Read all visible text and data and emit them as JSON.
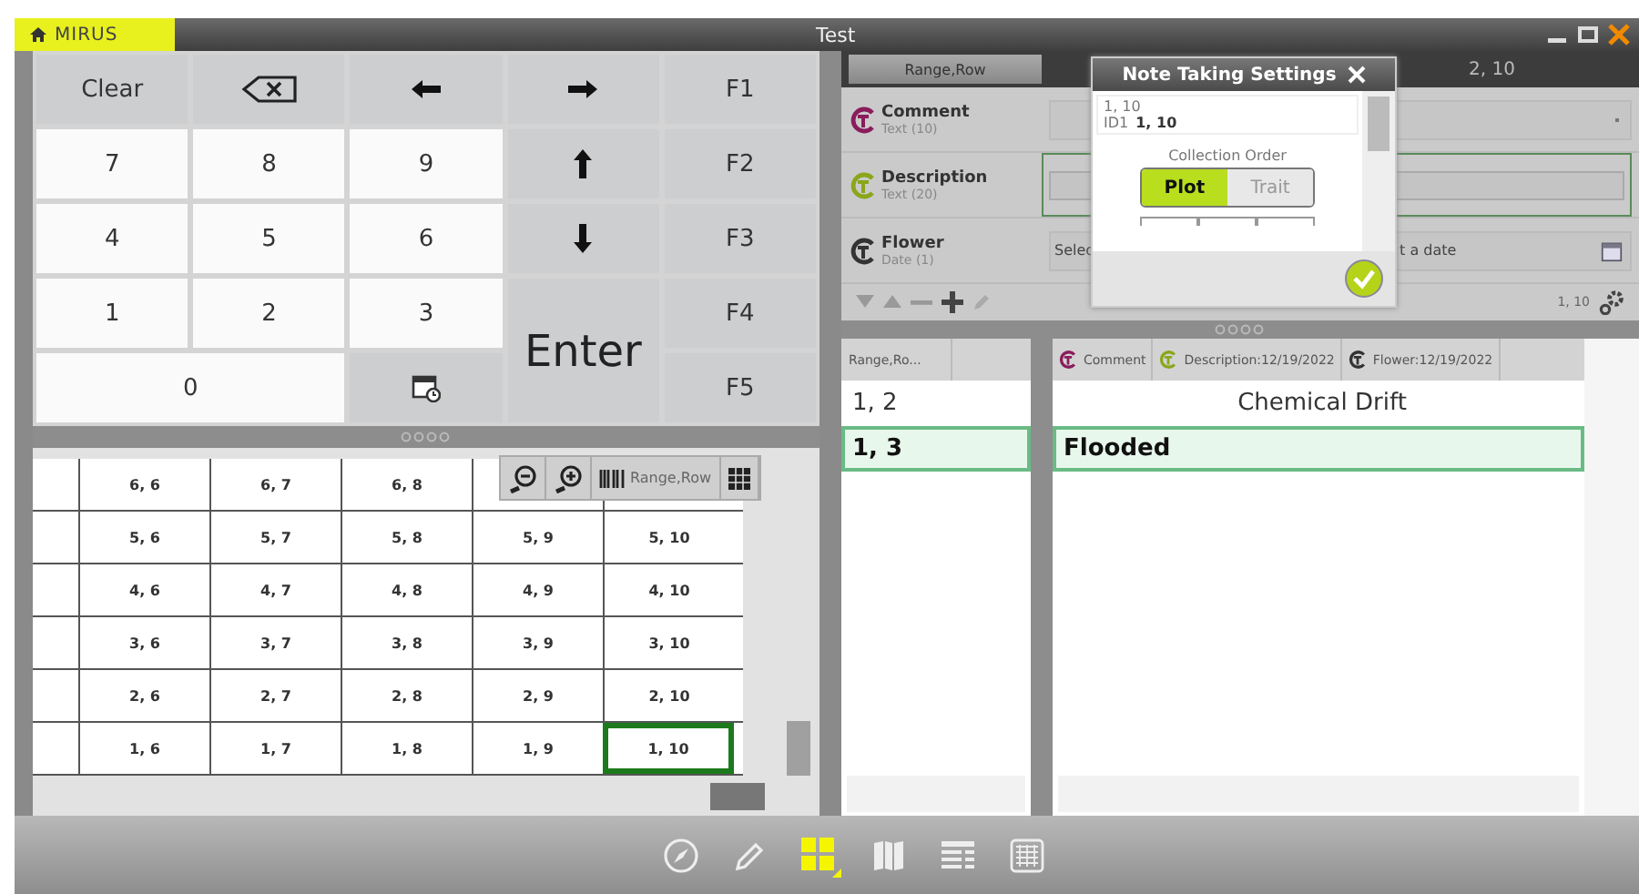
{
  "window": {
    "brand": "MIRUS",
    "title": "Test"
  },
  "keypad": [
    {
      "kind": "text",
      "label": "Clear"
    },
    {
      "kind": "backspace"
    },
    {
      "kind": "left"
    },
    {
      "kind": "right"
    },
    {
      "kind": "text",
      "label": "F1"
    },
    {
      "kind": "digit",
      "label": "7"
    },
    {
      "kind": "digit",
      "label": "8"
    },
    {
      "kind": "digit",
      "label": "9"
    },
    {
      "kind": "up"
    },
    {
      "kind": "text",
      "label": "F2"
    },
    {
      "kind": "digit",
      "label": "4"
    },
    {
      "kind": "digit",
      "label": "5"
    },
    {
      "kind": "digit",
      "label": "6"
    },
    {
      "kind": "down"
    },
    {
      "kind": "text",
      "label": "F3"
    },
    {
      "kind": "digit",
      "label": "1"
    },
    {
      "kind": "digit",
      "label": "2"
    },
    {
      "kind": "digit",
      "label": "3"
    },
    {
      "kind": "enter",
      "label": "Enter"
    },
    {
      "kind": "text",
      "label": "F4"
    },
    {
      "kind": "zero",
      "label": "0"
    },
    {
      "kind": "calendar"
    },
    {
      "kind": "text",
      "label": "F5"
    }
  ],
  "plot_grid": {
    "rows": [
      [
        {
          "text": "6, 6",
          "selected": false
        },
        {
          "text": "6, 7",
          "selected": false
        },
        {
          "text": "6, 8",
          "selected": false
        }
      ],
      [
        {
          "text": "5, 6",
          "selected": false
        },
        {
          "text": "5, 7",
          "selected": false
        },
        {
          "text": "5, 8",
          "selected": false
        },
        {
          "text": "5, 9",
          "selected": false
        },
        {
          "text": "5, 10",
          "selected": false
        }
      ],
      [
        {
          "text": "4, 6",
          "selected": false
        },
        {
          "text": "4, 7",
          "selected": false
        },
        {
          "text": "4, 8",
          "selected": false
        },
        {
          "text": "4, 9",
          "selected": false
        },
        {
          "text": "4, 10",
          "selected": false
        }
      ],
      [
        {
          "text": "3, 6",
          "selected": false
        },
        {
          "text": "3, 7",
          "selected": false
        },
        {
          "text": "3, 8",
          "selected": false
        },
        {
          "text": "3, 9",
          "selected": false
        },
        {
          "text": "3, 10",
          "selected": false
        }
      ],
      [
        {
          "text": "2, 6",
          "selected": false
        },
        {
          "text": "2, 7",
          "selected": false
        },
        {
          "text": "2, 8",
          "selected": false
        },
        {
          "text": "2, 9",
          "selected": false
        },
        {
          "text": "2, 10",
          "selected": false
        }
      ],
      [
        {
          "text": "1, 6",
          "selected": false
        },
        {
          "text": "1, 7",
          "selected": false
        },
        {
          "text": "1, 8",
          "selected": false
        },
        {
          "text": "1, 9",
          "selected": false
        },
        {
          "text": "1, 10",
          "selected": true
        }
      ]
    ],
    "toolbar_label": "Range,Row"
  },
  "entry": {
    "range_row_button": "Range,Row",
    "current_plot": "2, 10",
    "traits": [
      {
        "name": "Comment",
        "type": "Text (10)",
        "color": "#8a1c5c",
        "kind": "dropdown"
      },
      {
        "name": "Description",
        "type": "Text (20)",
        "color": "#8aa61a",
        "kind": "text"
      },
      {
        "name": "Flower",
        "type": "Date (1)",
        "color": "#333333",
        "kind": "date",
        "value_start": "Selec",
        "value_end": "t a date"
      }
    ],
    "position": "1, 10"
  },
  "dialog": {
    "title": "Note Taking Settings",
    "line_1": "1, 10",
    "id_label": "ID1",
    "id_value": "1, 10",
    "order_label": "Collection Order",
    "options": [
      {
        "label": "Plot",
        "selected": true
      },
      {
        "label": "Trait",
        "selected": false
      }
    ]
  },
  "notes": {
    "left_header": "Range,Ro...",
    "left_rows": [
      {
        "text": "1, 2",
        "selected": false
      },
      {
        "text": "1, 3",
        "selected": true
      }
    ],
    "columns": [
      {
        "label": "Comment",
        "color": "#8a1c5c"
      },
      {
        "label": "Description:12/19/2022",
        "color": "#8aa61a"
      },
      {
        "label": "Flower:12/19/2022",
        "color": "#333333"
      }
    ],
    "rows": [
      {
        "text": "Chemical Drift",
        "selected": false
      },
      {
        "text": "Flooded",
        "selected": true
      }
    ]
  },
  "view_buttons": [
    {
      "kind": "compass",
      "selected": false
    },
    {
      "kind": "pencil",
      "selected": false
    },
    {
      "kind": "tiles",
      "selected": true
    },
    {
      "kind": "map",
      "selected": false
    },
    {
      "kind": "list",
      "selected": false
    },
    {
      "kind": "table",
      "selected": false
    }
  ]
}
